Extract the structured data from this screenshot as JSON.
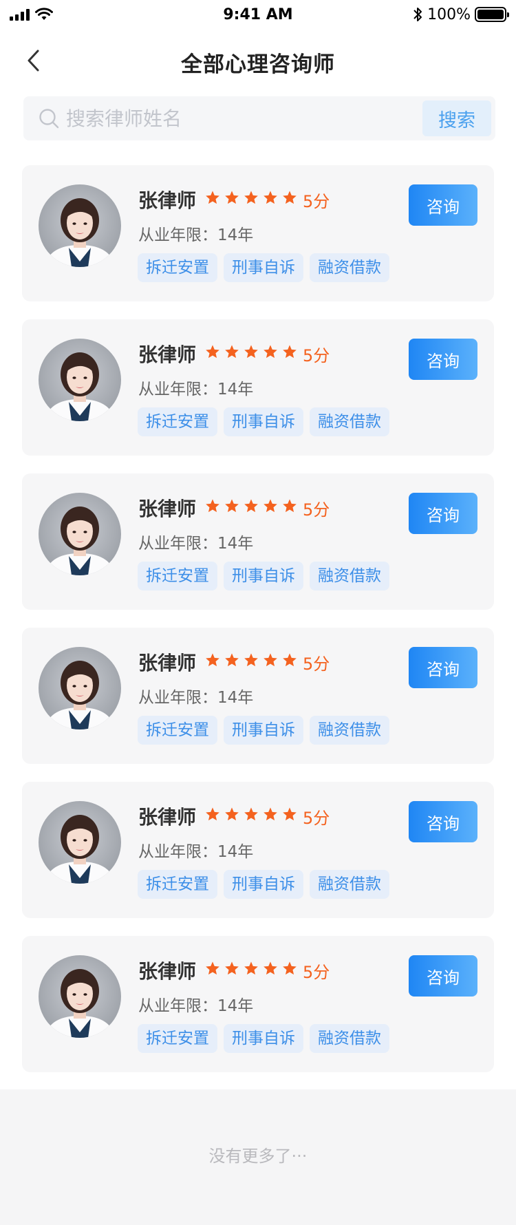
{
  "status_bar": {
    "time": "9:41 AM",
    "battery": "100%"
  },
  "nav": {
    "title": "全部心理咨询师"
  },
  "search": {
    "placeholder": "搜索律师姓名",
    "button_label": "搜索"
  },
  "colors": {
    "accent": "#1f86f4",
    "star": "#f4621f",
    "tag_text": "#3d8fe8"
  },
  "counselors": [
    {
      "name": "张律师",
      "rating": 5,
      "score": "5分",
      "years": "从业年限：14年",
      "tags": [
        "拆迁安置",
        "刑事自诉",
        "融资借款"
      ],
      "button": "咨询"
    },
    {
      "name": "张律师",
      "rating": 5,
      "score": "5分",
      "years": "从业年限：14年",
      "tags": [
        "拆迁安置",
        "刑事自诉",
        "融资借款"
      ],
      "button": "咨询"
    },
    {
      "name": "张律师",
      "rating": 5,
      "score": "5分",
      "years": "从业年限：14年",
      "tags": [
        "拆迁安置",
        "刑事自诉",
        "融资借款"
      ],
      "button": "咨询"
    },
    {
      "name": "张律师",
      "rating": 5,
      "score": "5分",
      "years": "从业年限：14年",
      "tags": [
        "拆迁安置",
        "刑事自诉",
        "融资借款"
      ],
      "button": "咨询"
    },
    {
      "name": "张律师",
      "rating": 5,
      "score": "5分",
      "years": "从业年限：14年",
      "tags": [
        "拆迁安置",
        "刑事自诉",
        "融资借款"
      ],
      "button": "咨询"
    },
    {
      "name": "张律师",
      "rating": 5,
      "score": "5分",
      "years": "从业年限：14年",
      "tags": [
        "拆迁安置",
        "刑事自诉",
        "融资借款"
      ],
      "button": "咨询"
    }
  ],
  "footer": {
    "text": "没有更多了···"
  }
}
